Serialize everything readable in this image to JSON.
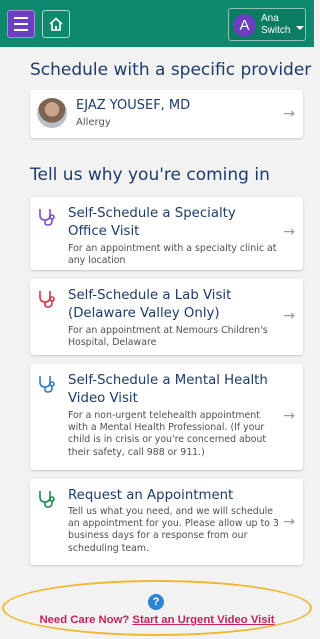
{
  "topbar": {
    "background": "#0d8a6e",
    "menu_icon": "hamburger-icon",
    "home_icon": "home-icon",
    "user": {
      "initial": "A",
      "name": "Ana",
      "action": "Switch"
    }
  },
  "provider_section": {
    "heading": "Schedule with a specific provider",
    "provider": {
      "name": "EJAZ YOUSEF, MD",
      "specialty": "Allergy"
    }
  },
  "visit_section": {
    "heading": "Tell us why you're coming in",
    "options": [
      {
        "title": "Self-Schedule a Specialty Office Visit",
        "description": "For an appointment with a specialty clinic at any location",
        "icon_color": "#7b4fc8"
      },
      {
        "title": "Self-Schedule a Lab Visit (Delaware Valley Only)",
        "description": "For an appointment at Nemours Children's Hospital, Delaware",
        "icon_color": "#d2344a"
      },
      {
        "title": "Self-Schedule a Mental Health Video Visit",
        "description": "For a non-urgent telehealth appointment with a Mental Health Professional. (If your child is in crisis or you're concerned about their safety, call 988 or 911.)",
        "icon_color": "#2d7fc4"
      },
      {
        "title": "Request an Appointment",
        "description": "Tell us what you need, and we will schedule an appointment for you. Please allow up to 3 business days for a response from our scheduling team.",
        "icon_color": "#1f8a4c"
      }
    ]
  },
  "urgent": {
    "prefix": "Need Care Now?",
    "link": "Start an Urgent Video Visit",
    "help_icon": "?",
    "color": "#c8215a"
  }
}
